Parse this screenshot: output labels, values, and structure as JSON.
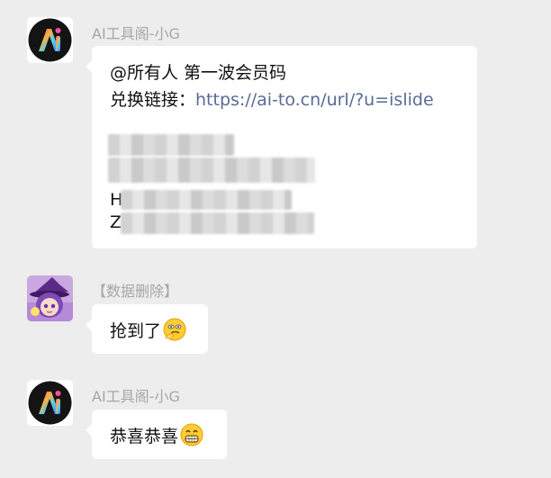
{
  "messages": [
    {
      "sender": "AI工具阁-小G",
      "avatar": "ai-logo-avatar",
      "lines": [
        {
          "text": "@所有人 第一波会员码"
        },
        {
          "prefix": "兑换链接：",
          "link": "https://ai-to.cn/url/?u=islide"
        }
      ],
      "partial_lines": [
        "H",
        "Z"
      ],
      "redaction_note": "blurred codes"
    },
    {
      "sender": "【数据删除】",
      "avatar": "anime-witch-avatar",
      "text": "抢到了",
      "emoji": "thinking-face-emoji"
    },
    {
      "sender": "AI工具阁-小G",
      "avatar": "ai-logo-avatar",
      "text": "恭喜恭喜",
      "emoji": "grinning-face-emoji"
    }
  ],
  "colors": {
    "background": "#ededed",
    "bubble": "#ffffff",
    "link": "#576b95",
    "sender": "#a6a6a6"
  }
}
